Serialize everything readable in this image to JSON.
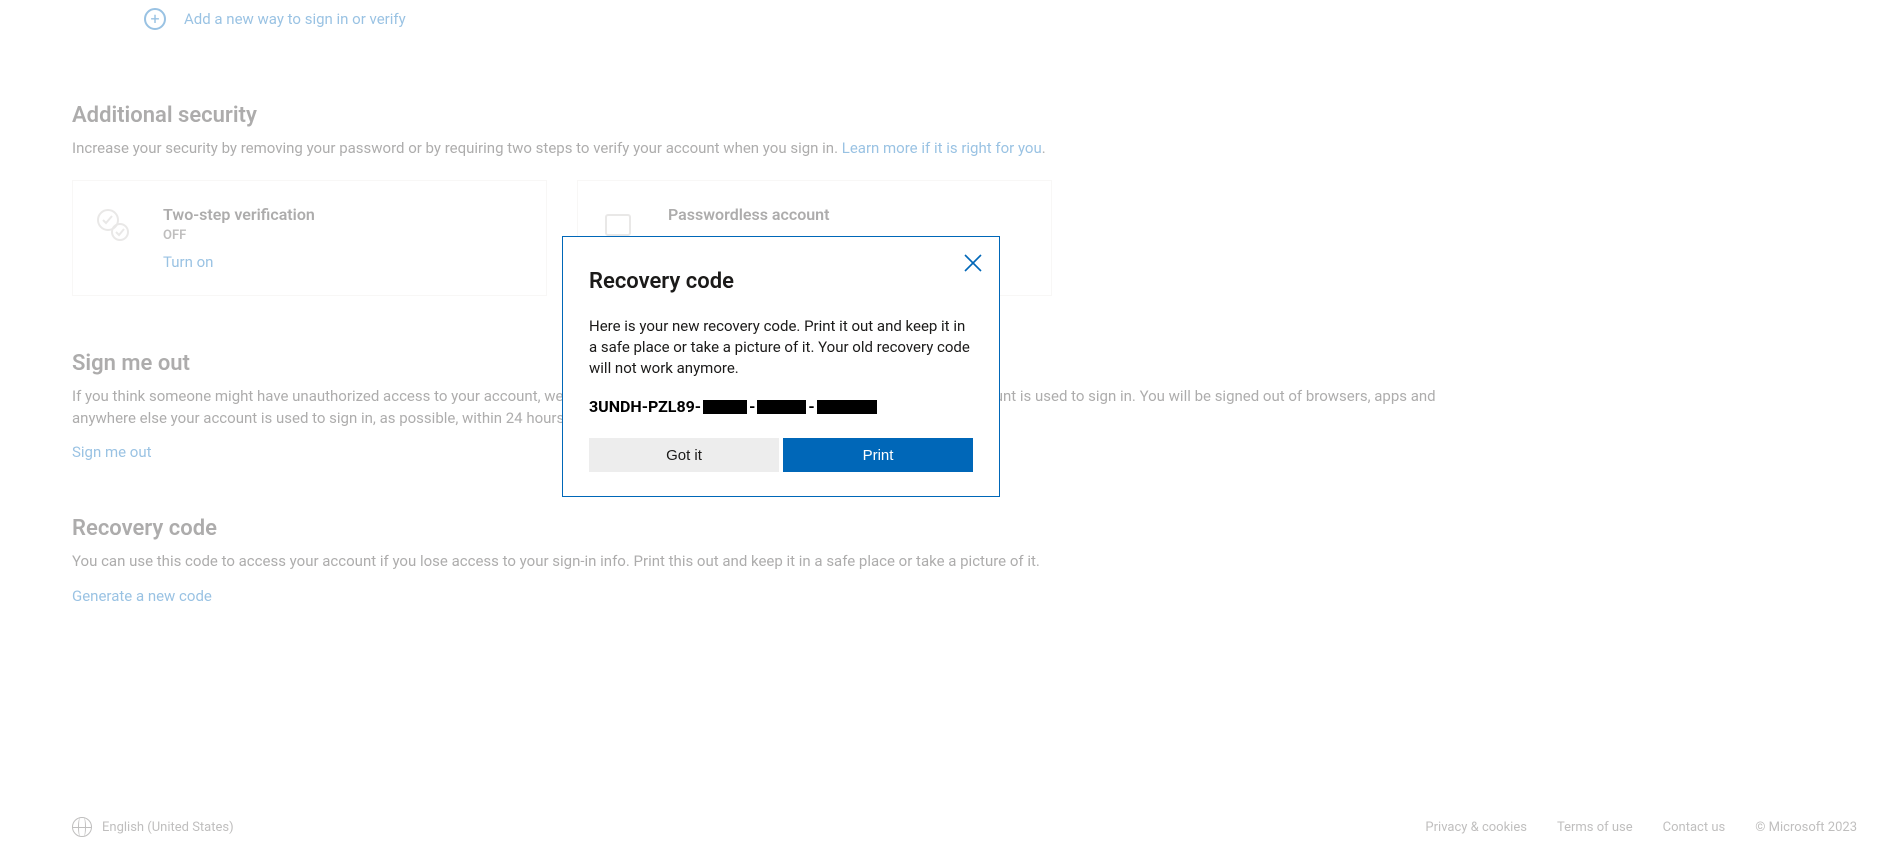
{
  "top_link": {
    "label": "Add a new way to sign in or verify"
  },
  "sections": {
    "additional_security": {
      "heading": "Additional security",
      "desc_prefix": "Increase your security by removing your password or by requiring two steps to verify your account when you sign in. ",
      "desc_link": "Learn more if it is right for you",
      "desc_suffix": "."
    },
    "two_step": {
      "title": "Two-step verification",
      "state": "OFF",
      "action": "Turn on"
    },
    "passwordless": {
      "title": "Passwordless account"
    },
    "sign_out": {
      "heading": "Sign me out",
      "desc": "If you think someone might have unauthorized access to your account, we can sign you out of browsers, apps and anywhere else your account is used to sign in. You will be signed out of browsers, apps and anywhere else your account is used to sign in, as possible, within 24 hours. We can't sign you out of some places, like the Xbox console.",
      "action": "Sign me out"
    },
    "recovery": {
      "heading": "Recovery code",
      "desc": "You can use this code to access your account if you lose access to your sign-in info. Print this out and keep it in a safe place or take a picture of it.",
      "action": "Generate a new code"
    }
  },
  "footer": {
    "language": "English (United States)",
    "links": {
      "privacy": "Privacy & cookies",
      "terms": "Terms of use",
      "contact": "Contact us",
      "copyright": "© Microsoft 2023"
    }
  },
  "modal": {
    "title": "Recovery code",
    "body": "Here is your new recovery code. Print it out and keep it in a safe place or take a picture of it. Your old recovery code will not work anymore.",
    "code_prefix": "3UNDH-PZL89-",
    "got_it": "Got it",
    "print": "Print"
  }
}
